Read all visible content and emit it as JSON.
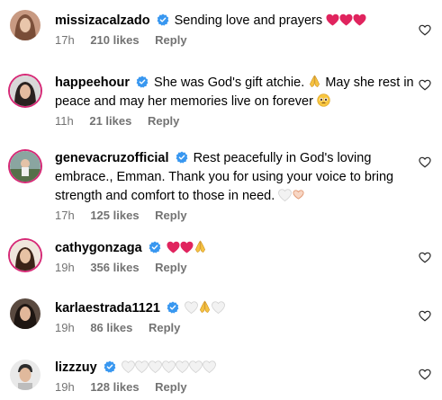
{
  "comments": [
    {
      "username": "missizacalzado",
      "text": "Sending love and prayers",
      "time": "17h",
      "likes": "210 likes",
      "reply": "Reply",
      "emoji": [
        "red-heart",
        "red-heart",
        "red-heart"
      ]
    },
    {
      "username": "happeehour",
      "text_line1": "She was God's gift atchie.",
      "text_line1b": "May she rest in",
      "text_line2": "peace and may her memories live on forever",
      "time": "11h",
      "likes": "21 likes",
      "reply": "Reply"
    },
    {
      "username": "genevacruzofficial",
      "text_line1": "Rest peacefully in God's loving",
      "text_line2": "embrace., Emman. Thank you for using your voice to bring",
      "text_line3": "strength and comfort to those in need.",
      "time": "17h",
      "likes": "125 likes",
      "reply": "Reply"
    },
    {
      "username": "cathygonzaga",
      "text": "",
      "time": "19h",
      "likes": "356 likes",
      "reply": "Reply"
    },
    {
      "username": "karlaestrada1121",
      "text": "",
      "time": "19h",
      "likes": "86 likes",
      "reply": "Reply"
    },
    {
      "username": "lizzzuy",
      "text": "",
      "time": "19h",
      "likes": "128 likes",
      "reply": "Reply"
    }
  ],
  "colors": {
    "verified": "#3897f0",
    "meta": "#737373",
    "heart": "#e0245e"
  }
}
